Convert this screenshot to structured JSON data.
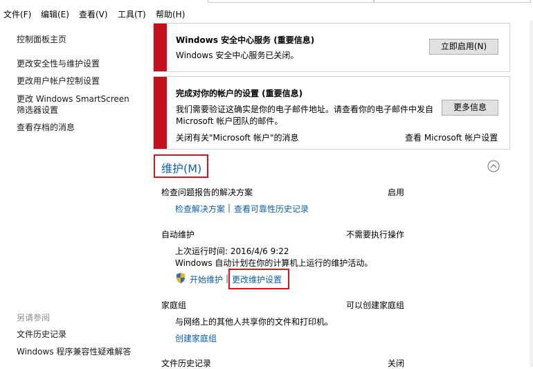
{
  "menu": [
    "文件(F)",
    "编辑(E)",
    "查看(V)",
    "工具(T)",
    "帮助(H)"
  ],
  "sidebar": {
    "links": [
      "控制面板主页",
      "更改安全性与维护设置",
      "更改用户帐户控制设置",
      "更改 Windows SmartScreen",
      "筛选器设置",
      "查看存档的消息"
    ],
    "see_also_title": "另请参阅",
    "see_also": [
      "文件历史记录",
      "Windows 程序兼容性疑难解答"
    ]
  },
  "alerts": [
    {
      "title": "Windows 安全中心服务 (重要信息)",
      "text": "Windows 安全中心服务已关闭。",
      "button": "立即启用(N)"
    },
    {
      "title": "完成对你的帐户的设置 (重要信息)",
      "text1": "我们需要验证这确实是你的电子邮件地址。请查看你的电子邮件中发自",
      "text2": "Microsoft 帐户团队的邮件。",
      "button": "更多信息",
      "link_left": "关闭有关\"Microsoft 帐户\"的消息",
      "link_right": "查看 Microsoft 帐户设置"
    }
  ],
  "maintenance": {
    "heading": "维护(M)",
    "report": {
      "label": "检查问题报告的解决方案",
      "status": "启用",
      "link1": "检查解决方案",
      "sep": "|",
      "link2": "查看可靠性历史记录"
    },
    "auto": {
      "label": "自动维护",
      "status": "不需要执行操作",
      "last_run": "上次运行时间: 2016/4/6 9:22",
      "desc": "Windows 自动计划在你的计算机上运行的维护活动。",
      "start_link": "开始维护",
      "sep": "|",
      "change_link": "更改维护设置"
    },
    "homegroup": {
      "label": "家庭组",
      "status": "可以创建家庭组",
      "desc": "与网络上的其他人共享你的文件和打印机。",
      "link": "创建家庭组"
    },
    "filehistory": {
      "label": "文件历史记录",
      "status": "关闭"
    }
  }
}
